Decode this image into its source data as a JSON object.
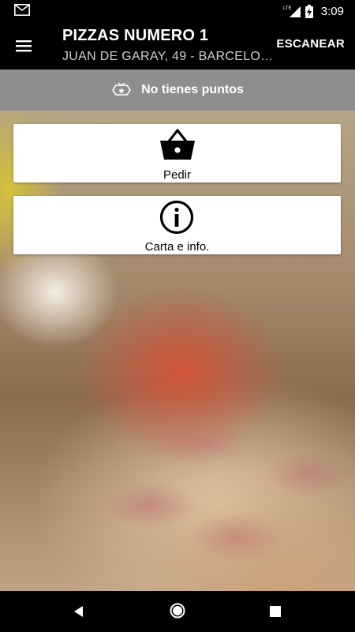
{
  "status_bar": {
    "time": "3:09",
    "network": "LTE",
    "icons": [
      "gmail-icon",
      "lte-signal-icon",
      "battery-charging-icon"
    ]
  },
  "app_bar": {
    "title": "PIZZAS NUMERO 1",
    "subtitle": "JUAN DE GARAY, 49 - BARCELO…",
    "scan_label": "ESCANEAR",
    "menu_icon": "hamburger-menu-icon"
  },
  "points": {
    "label": "No tienes puntos",
    "icon": "points-badge-icon"
  },
  "actions": [
    {
      "label": "Pedir",
      "icon": "basket-icon"
    },
    {
      "label": "Carta e info.",
      "icon": "info-icon"
    }
  ],
  "nav_bar": {
    "icons": [
      "back-icon",
      "home-icon",
      "recents-icon"
    ]
  },
  "colors": {
    "app_bar": "#000000",
    "points_bar": "#8e8e8e",
    "card": "#ffffff"
  }
}
